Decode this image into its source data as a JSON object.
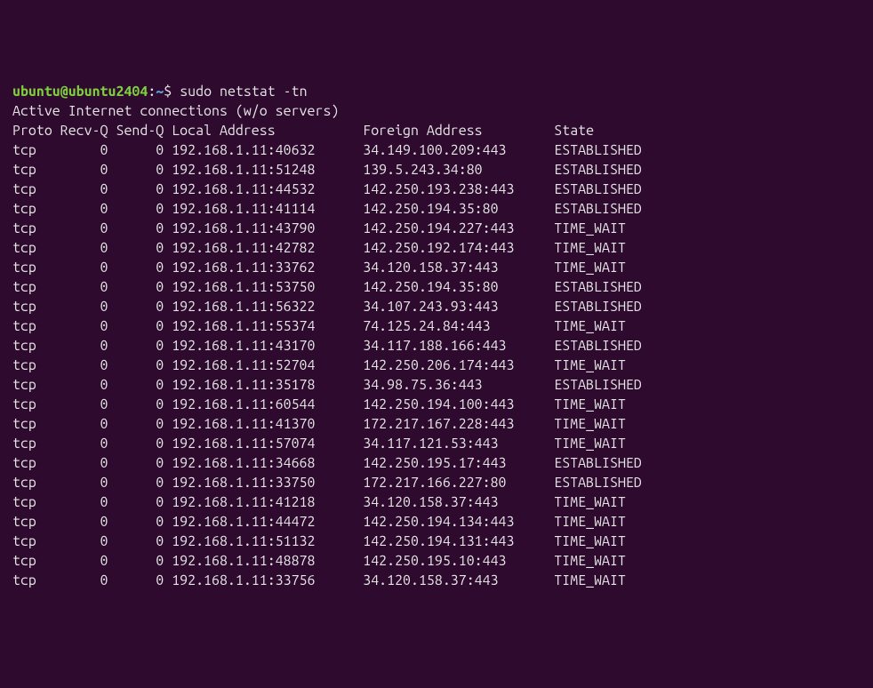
{
  "prompt": {
    "user_host": "ubuntu@ubuntu2404",
    "colon": ":",
    "tilde": "~",
    "dollar": "$",
    "command": " sudo netstat -tn"
  },
  "title_line": "Active Internet connections (w/o servers)",
  "header_line": "Proto Recv-Q Send-Q Local Address           Foreign Address         State      ",
  "rows": [
    "tcp        0      0 192.168.1.11:40632      34.149.100.209:443      ESTABLISHED",
    "tcp        0      0 192.168.1.11:51248      139.5.243.34:80         ESTABLISHED",
    "tcp        0      0 192.168.1.11:44532      142.250.193.238:443     ESTABLISHED",
    "tcp        0      0 192.168.1.11:41114      142.250.194.35:80       ESTABLISHED",
    "tcp        0      0 192.168.1.11:43790      142.250.194.227:443     TIME_WAIT  ",
    "tcp        0      0 192.168.1.11:42782      142.250.192.174:443     TIME_WAIT  ",
    "tcp        0      0 192.168.1.11:33762      34.120.158.37:443       TIME_WAIT  ",
    "tcp        0      0 192.168.1.11:53750      142.250.194.35:80       ESTABLISHED",
    "tcp        0      0 192.168.1.11:56322      34.107.243.93:443       ESTABLISHED",
    "tcp        0      0 192.168.1.11:55374      74.125.24.84:443        TIME_WAIT  ",
    "tcp        0      0 192.168.1.11:43170      34.117.188.166:443      ESTABLISHED",
    "tcp        0      0 192.168.1.11:52704      142.250.206.174:443     TIME_WAIT  ",
    "tcp        0      0 192.168.1.11:35178      34.98.75.36:443         ESTABLISHED",
    "tcp        0      0 192.168.1.11:60544      142.250.194.100:443     TIME_WAIT  ",
    "tcp        0      0 192.168.1.11:41370      172.217.167.228:443     TIME_WAIT  ",
    "tcp        0      0 192.168.1.11:57074      34.117.121.53:443       TIME_WAIT  ",
    "tcp        0      0 192.168.1.11:34668      142.250.195.17:443      ESTABLISHED",
    "tcp        0      0 192.168.1.11:33750      172.217.166.227:80      ESTABLISHED",
    "tcp        0      0 192.168.1.11:41218      34.120.158.37:443       TIME_WAIT  ",
    "tcp        0      0 192.168.1.11:44472      142.250.194.134:443     TIME_WAIT  ",
    "tcp        0      0 192.168.1.11:51132      142.250.194.131:443     TIME_WAIT  ",
    "tcp        0      0 192.168.1.11:48878      142.250.195.10:443      TIME_WAIT  ",
    "tcp        0      0 192.168.1.11:33756      34.120.158.37:443       TIME_WAIT  "
  ]
}
